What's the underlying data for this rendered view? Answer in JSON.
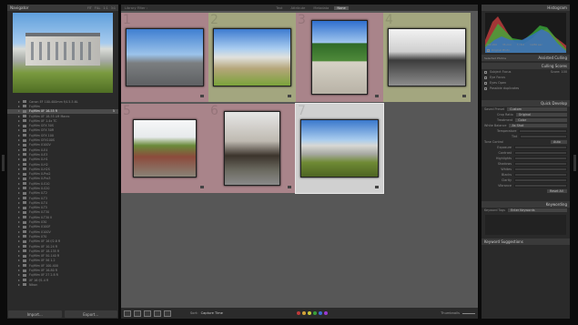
{
  "navigator": {
    "title": "Navigator",
    "zoom_options": [
      "FIT",
      "FILL",
      "1:1",
      "3:1"
    ]
  },
  "folders": [
    {
      "name": "Canon EF 100-400mm f/4.5-5.6L",
      "count": "",
      "selected": false
    },
    {
      "name": "Fujifilm",
      "count": "",
      "selected": false
    },
    {
      "name": "Fujifilm XF 16-55 R",
      "count": "5",
      "selected": true
    },
    {
      "name": "Fujifilm XF 18-55 LM Macro",
      "count": "",
      "selected": false
    },
    {
      "name": "Fujifilm XF 1.4x TC",
      "count": "",
      "selected": false
    },
    {
      "name": "Fujifilm GFX 50S",
      "count": "",
      "selected": false
    },
    {
      "name": "Fujifilm GFX 50R",
      "count": "",
      "selected": false
    },
    {
      "name": "Fujifilm GFX 100",
      "count": "",
      "selected": false
    },
    {
      "name": "Fujifilm GFX100S",
      "count": "",
      "selected": false
    },
    {
      "name": "Fujifilm X100V",
      "count": "",
      "selected": false
    },
    {
      "name": "Fujifilm X-E4",
      "count": "",
      "selected": false
    },
    {
      "name": "Fujifilm X-E3",
      "count": "",
      "selected": false
    },
    {
      "name": "Fujifilm X-H1",
      "count": "",
      "selected": false
    },
    {
      "name": "Fujifilm X-H2",
      "count": "",
      "selected": false
    },
    {
      "name": "Fujifilm X-H2S",
      "count": "",
      "selected": false
    },
    {
      "name": "Fujifilm X-Pro2",
      "count": "",
      "selected": false
    },
    {
      "name": "Fujifilm X-Pro3",
      "count": "",
      "selected": false
    },
    {
      "name": "Fujifilm X-S10",
      "count": "",
      "selected": false
    },
    {
      "name": "Fujifilm X-S20",
      "count": "",
      "selected": false
    },
    {
      "name": "Fujifilm X-T2",
      "count": "",
      "selected": false
    },
    {
      "name": "Fujifilm X-T3",
      "count": "",
      "selected": false
    },
    {
      "name": "Fujifilm X-T4",
      "count": "",
      "selected": false
    },
    {
      "name": "Fujifilm X-T5",
      "count": "",
      "selected": false
    },
    {
      "name": "Fujifilm X-T30",
      "count": "",
      "selected": false
    },
    {
      "name": "Fujifilm X-T30 II",
      "count": "",
      "selected": false
    },
    {
      "name": "Fujifilm X30",
      "count": "",
      "selected": false
    },
    {
      "name": "Fujifilm X100F",
      "count": "",
      "selected": false
    },
    {
      "name": "Fujifilm X100V",
      "count": "",
      "selected": false
    },
    {
      "name": "Fujifilm X70",
      "count": "",
      "selected": false
    },
    {
      "name": "Fujifilm XF 16 f/2.8 R",
      "count": "",
      "selected": false
    },
    {
      "name": "Fujifilm XF 10-24 R",
      "count": "",
      "selected": false
    },
    {
      "name": "Fujifilm XF 18-135 R",
      "count": "",
      "selected": false
    },
    {
      "name": "Fujifilm XF 50-140 R",
      "count": "",
      "selected": false
    },
    {
      "name": "Fujifilm XF 56 1.2",
      "count": "",
      "selected": false
    },
    {
      "name": "Fujifilm XF 100-400",
      "count": "",
      "selected": false
    },
    {
      "name": "Fujifilm XF 16-80 R",
      "count": "",
      "selected": false
    },
    {
      "name": "Fujifilm XF 27 2.8 R",
      "count": "",
      "selected": false
    },
    {
      "name": "XF 16 f/1.4 R",
      "count": "",
      "selected": false
    },
    {
      "name": "Nikon",
      "count": "",
      "selected": false
    }
  ],
  "left_buttons": {
    "import": "Import...",
    "export": "Export..."
  },
  "center": {
    "title": "Library Filter :",
    "tabs": [
      "Text",
      "Attribute",
      "Metadata",
      "None"
    ],
    "active_tab": "None"
  },
  "thumbnails": [
    {
      "index": "1",
      "bg": "#a9848a",
      "scene": "sky-sphere",
      "selected": false
    },
    {
      "index": "2",
      "bg": "#a3a67f",
      "scene": "sky-building",
      "selected": false
    },
    {
      "index": "3",
      "bg": "#a9848a",
      "scene": "tree-tower",
      "selected": false
    },
    {
      "index": "4",
      "bg": "#a3a67f",
      "scene": "bw-building",
      "selected": false
    },
    {
      "index": "5",
      "bg": "#a9848a",
      "scene": "tree-wall",
      "selected": false
    },
    {
      "index": "6",
      "bg": "#a9848a",
      "scene": "modern-house",
      "selected": false
    },
    {
      "index": "7",
      "bg": "#d0d0d0",
      "scene": "building-lawn",
      "selected": true
    }
  ],
  "toolbar": {
    "sort_label": "Sort:",
    "sort_value": "Capture Time",
    "thumbnails_label": "Thumbnails",
    "label_colors": [
      "#c03a3a",
      "#d3a33a",
      "#c9c93a",
      "#3aa03a",
      "#3a6ed3",
      "#9a3ad3"
    ]
  },
  "histogram": {
    "title": "Histogram",
    "readout": [
      "ISO 200",
      "35 mm",
      "f / 8.0",
      "1/250 sec"
    ],
    "original_label": "Original Photo"
  },
  "culling": {
    "title": "Assisted Culling",
    "selected_label": "Selected Photos",
    "select_label": "Select Photos"
  },
  "calling_scores": {
    "title": "Culling Scores",
    "items": [
      {
        "label": "Subject Focus",
        "value": "Score: 100"
      },
      {
        "label": "Eye Focus",
        "value": ""
      },
      {
        "label": "Eyes Open",
        "value": ""
      },
      {
        "label": "Possible duplicates",
        "value": ""
      }
    ]
  },
  "quick_develop": {
    "title": "Quick Develop",
    "saved_preset_label": "Saved Preset",
    "saved_preset_value": "Custom",
    "crop_ratio_label": "Crop Ratio",
    "crop_ratio_value": "Original",
    "treatment_label": "Treatment",
    "treatment_value": "Color",
    "white_balance_label": "White Balance",
    "white_balance_value": "As Shot",
    "temp_label": "Temperature",
    "tint_label": "Tint",
    "tone_control_label": "Tone Control",
    "auto_label": "Auto",
    "tone_rows": [
      "Exposure",
      "Contrast",
      "Highlights",
      "Shadows",
      "Whites",
      "Blacks",
      "Clarity",
      "Vibrance"
    ],
    "reset_label": "Reset All"
  },
  "keywording": {
    "title": "Keywording",
    "tags_label": "Keyword Tags",
    "tags_value": "Enter Keywords",
    "suggestions_title": "Keyword Suggestions"
  }
}
